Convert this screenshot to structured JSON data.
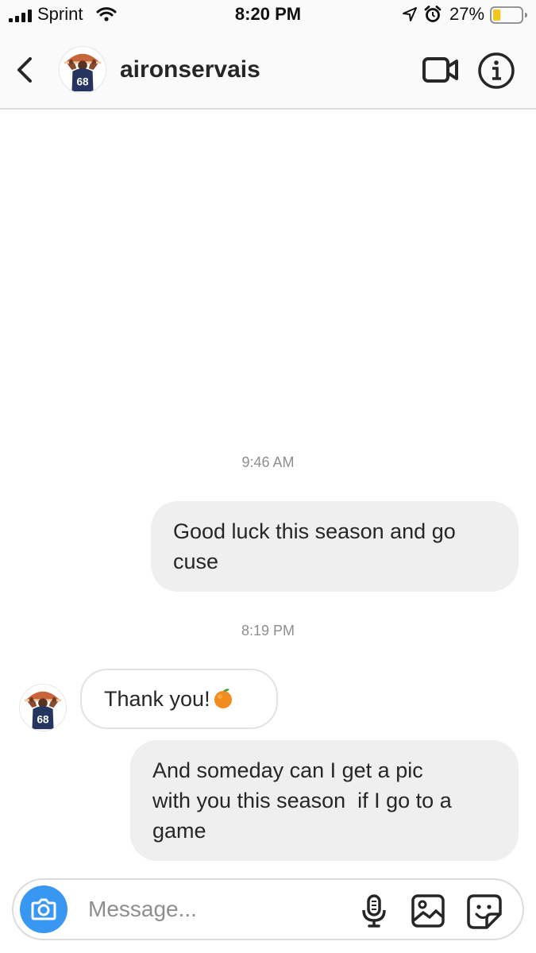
{
  "status_bar": {
    "carrier": "Sprint",
    "time": "8:20 PM",
    "battery_percent": "27%",
    "battery_level": 0.27,
    "icons": [
      "signal-icon",
      "wifi-icon",
      "location-arrow-icon",
      "alarm-icon",
      "battery-icon"
    ]
  },
  "header": {
    "username": "aironservais",
    "back_icon": "chevron-left-icon",
    "video_icon": "video-camera-icon",
    "info_icon": "info-icon",
    "avatar_jersey_number": "68"
  },
  "messages": [
    {
      "type": "timestamp",
      "text": "9:46 AM"
    },
    {
      "type": "outgoing",
      "lines": [
        "Good luck this season and go",
        "cuse"
      ]
    },
    {
      "type": "timestamp",
      "text": "8:19 PM"
    },
    {
      "type": "incoming",
      "text": "Thank you!",
      "emoji": "orange-emoji"
    },
    {
      "type": "outgoing",
      "lines": [
        "And someday can I get a pic",
        "with you this season  if I go to a",
        "game"
      ]
    }
  ],
  "composer": {
    "placeholder": "Message...",
    "icons": [
      "camera-icon",
      "microphone-icon",
      "gallery-icon",
      "sticker-icon"
    ]
  },
  "colors": {
    "accent": "#3897f0",
    "bubble_outgoing": "#efefef",
    "text": "#262626",
    "muted": "#8e8e8e",
    "battery_fill": "#f5c518"
  }
}
